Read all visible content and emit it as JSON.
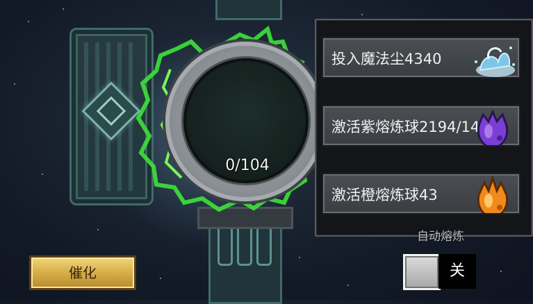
{
  "altar": {
    "progress_text": "0/104"
  },
  "panel": {
    "buttons": [
      {
        "label": "投入魔法尘4340",
        "icon": "magic-dust-icon"
      },
      {
        "label": "激活紫熔炼球2194/14",
        "icon": "purple-orb-icon"
      },
      {
        "label": "激活橙熔炼球43",
        "icon": "orange-orb-icon"
      }
    ]
  },
  "auto_smelt": {
    "label": "自动熔炼",
    "state": "关"
  },
  "catalyze": {
    "label": "催化"
  },
  "colors": {
    "energy_green": "#3ee23a",
    "gold_button": "#d9b24d",
    "purple_orb": "#7a3fd6",
    "orange_orb": "#f08a1c",
    "dust_blue": "#7ec6e8"
  }
}
